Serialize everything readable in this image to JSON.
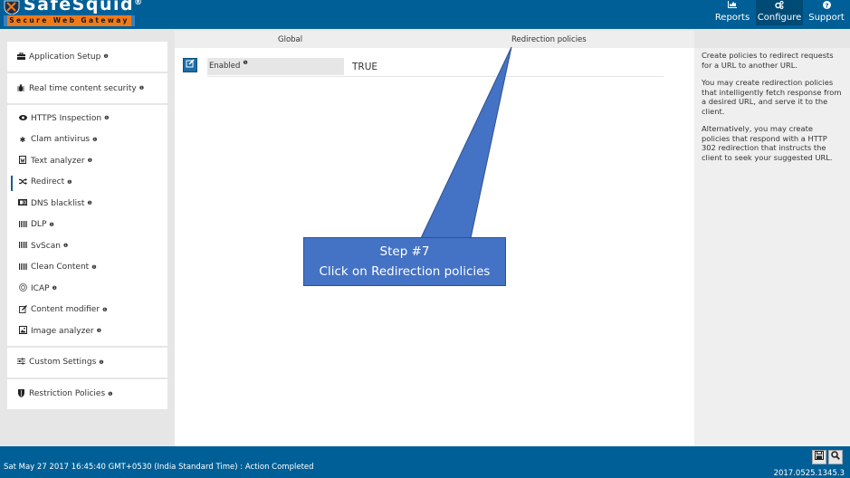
{
  "header": {
    "brand": "SafeSquid",
    "registered": "®",
    "tagline": "Secure Web Gateway",
    "nav": [
      {
        "label": "Reports",
        "icon": "area-chart-icon"
      },
      {
        "label": "Configure",
        "icon": "cogs-icon",
        "active": true
      },
      {
        "label": "Support",
        "icon": "question-circle-icon"
      }
    ]
  },
  "sidebar": {
    "info_glyph": "❶",
    "top_items": [
      {
        "label": "Application Setup",
        "icon": "briefcase-icon"
      },
      {
        "label": "Real time content security",
        "icon": "bug-icon"
      }
    ],
    "group_items": [
      {
        "label": "HTTPS Inspection",
        "icon": "eye-icon"
      },
      {
        "label": "Clam antivirus",
        "icon": "asterisk-icon"
      },
      {
        "label": "Text analyzer",
        "icon": "file-word-icon"
      },
      {
        "label": "Redirect",
        "icon": "random-icon",
        "active": true
      },
      {
        "label": "DNS blacklist",
        "icon": "id-card-icon"
      },
      {
        "label": "DLP",
        "icon": "barcode-icon"
      },
      {
        "label": "SvScan",
        "icon": "barcode-icon"
      },
      {
        "label": "Clean Content",
        "icon": "barcode-icon"
      },
      {
        "label": "ICAP",
        "icon": "life-ring-icon"
      },
      {
        "label": "Content modifier",
        "icon": "edit-icon"
      },
      {
        "label": "Image analyzer",
        "icon": "image-icon"
      }
    ],
    "bottom_items": [
      {
        "label": "Custom Settings",
        "icon": "sliders-icon"
      },
      {
        "label": "Restriction Policies",
        "icon": "shield-icon"
      }
    ]
  },
  "main": {
    "tabs": [
      {
        "label": "Global"
      },
      {
        "label": "Redirection policies"
      }
    ],
    "field": {
      "label": "Enabled",
      "value": "TRUE"
    }
  },
  "help": {
    "paragraphs": [
      "Create policies to redirect requests for a URL to another URL.",
      "You may create redirection policies that intelligently fetch response from a desired URL, and serve it to the client.",
      "Alternatively, you may create policies that respond with a HTTP 302 redirection that instructs the client to seek your suggested URL."
    ]
  },
  "callout": {
    "line1": "Step #7",
    "line2": "Click on Redirection policies",
    "color": "#4472c4"
  },
  "footer": {
    "status": "Sat May 27 2017 16:45:40 GMT+0530 (India Standard Time) : Action Completed",
    "version": "2017.0525.1345.3"
  }
}
